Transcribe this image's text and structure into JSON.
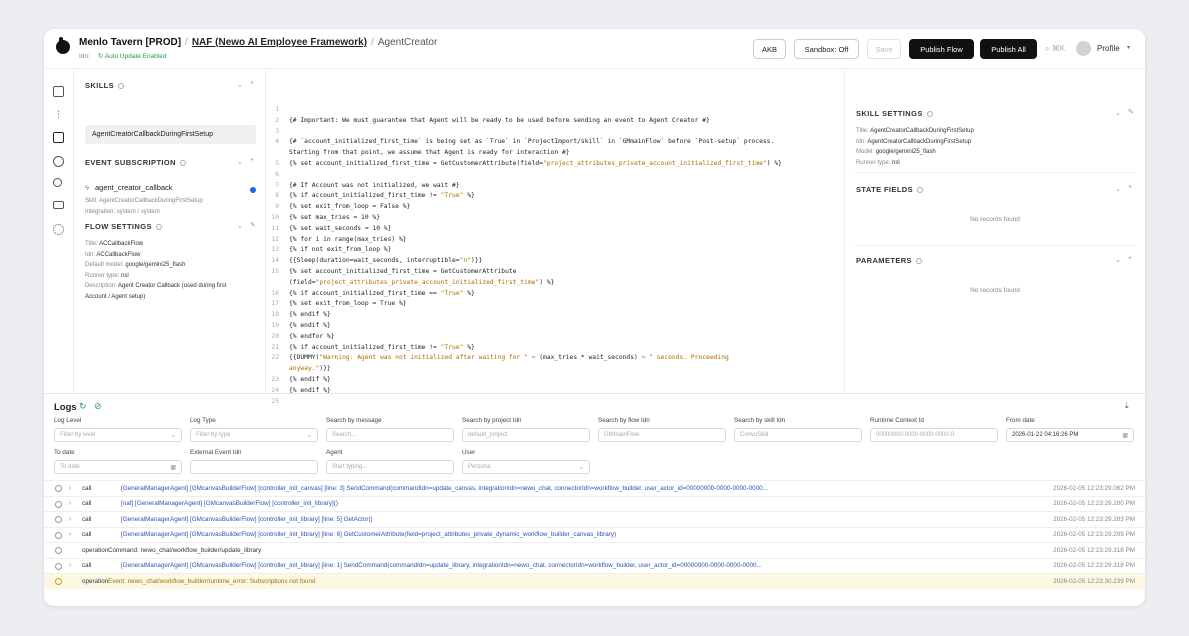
{
  "header": {
    "org": "Menlo Tavern [PROD]",
    "project": "NAF (Newo AI Employee Framework)",
    "page": "AgentCreator",
    "idn_label": "Idn:",
    "auto_update": "↻ Auto Update Enabled",
    "buttons": {
      "akb": "AKB",
      "sandbox": "Sandbox: Off",
      "save": "Save",
      "publish_flow": "Publish Flow",
      "publish_all": "Publish All"
    },
    "search_shortcut": "⌕ ⌘K",
    "profile": "Profile"
  },
  "skills": {
    "title": "SKILLS",
    "selected": "AgentCreatorCallbackDuringFirstSetup"
  },
  "event_subscription": {
    "title": "EVENT SUBSCRIPTION",
    "event": "agent_creator_callback",
    "skill_label": "Skill:",
    "skill": "AgentCreatorCallbackDuringFirstSetup",
    "integration_label": "Integration:",
    "integration": "system / system"
  },
  "flow_settings": {
    "title": "FLOW SETTINGS",
    "title_label": "Title:",
    "title_val": "ACCallbackFlow",
    "idn_label": "Idn:",
    "idn_val": "ACCallbackFlow",
    "model_label": "Default model:",
    "model_val": "google/gemini25_flash",
    "runner_label": "Runner type:",
    "runner_val": "nsl",
    "desc_label": "Description:",
    "desc_val1": "Agent Creator Callback (used during first",
    "desc_val2": "Account / Agent setup)"
  },
  "code": [
    {
      "n": "1",
      "t": ""
    },
    {
      "n": "2",
      "t": "{# Important: We must guarantee that Agent will be ready to be used before sending an event to Agent Creator #}"
    },
    {
      "n": "3",
      "t": ""
    },
    {
      "n": "4",
      "t": "{# `account_initialized_first_time` is being set as `True` in `ProjectImport/skill` in `GMmainFlow` before `Post-setup` process."
    },
    {
      "n": "",
      "t": "   Starting from that point, we assume that Agent is ready for interaction #}"
    },
    {
      "n": "5",
      "t": "{% set account_initialized_first_time = GetCustomerAttribute(field=",
      "s": "\"project_attributes_private_account_initialized_first_time\"",
      "e": ") %}"
    },
    {
      "n": "6",
      "t": ""
    },
    {
      "n": "7",
      "t": "{# If Account was not initialized, we wait #}"
    },
    {
      "n": "8",
      "t": "{% if account_initialized_first_time != ",
      "s": "\"True\"",
      "e": " %}"
    },
    {
      "n": "9",
      "t": "    {% set exit_from_loop = False %}"
    },
    {
      "n": "10",
      "t": "    {% set max_tries = 10 %}"
    },
    {
      "n": "11",
      "t": "    {% set wait_seconds = 10 %}"
    },
    {
      "n": "12",
      "t": "    {% for i in range(max_tries) %}"
    },
    {
      "n": "13",
      "t": "        {% if not exit_from_loop %}"
    },
    {
      "n": "14",
      "t": "            {{Sleep(duration=wait_seconds, interruptible=",
      "s": "\"n\"",
      "e": ")}}"
    },
    {
      "n": "15",
      "t": "            {% set account_initialized_first_time = GetCustomerAttribute"
    },
    {
      "n": "",
      "t": "            (field=",
      "s": "\"project_attributes_private_account_initialized_first_time\"",
      "e": ") %}"
    },
    {
      "n": "16",
      "t": "            {% if account_initialized_first_time == ",
      "s": "\"True\"",
      "e": " %}"
    },
    {
      "n": "17",
      "t": "                {% set exit_from_loop = True %}"
    },
    {
      "n": "18",
      "t": "            {% endif %}"
    },
    {
      "n": "19",
      "t": "        {% endif %}"
    },
    {
      "n": "20",
      "t": "    {% endfor %}"
    },
    {
      "n": "21",
      "t": "    {% if account_initialized_first_time != ",
      "s": "\"True\"",
      "e": " %}"
    },
    {
      "n": "22",
      "t": "        {{DUMMY(",
      "s": "\"Warning: Agent was not initialized after waiting for \"",
      "e": " ~ (max_tries * wait_seconds) ~ ",
      "s2": "\" seconds. Proceeding"
    },
    {
      "n": "",
      "t": "",
      "s": "        anyway.\"",
      "e": ")}}"
    },
    {
      "n": "23",
      "t": "    {% endif %}"
    },
    {
      "n": "24",
      "t": "{% endif %}"
    },
    {
      "n": "25",
      "t": ""
    }
  ],
  "skill_settings": {
    "title": "SKILL SETTINGS",
    "title_label": "Title:",
    "title_val": "AgentCreatorCallbackDuringFirstSetup",
    "idn_label": "Idn:",
    "idn_val": "AgentCreatorCallbackDuringFirstSetup",
    "model_label": "Model:",
    "model_val": "google/gemini25_flash",
    "runner_label": "Runner type:",
    "runner_val": "nsl"
  },
  "state_fields": {
    "title": "STATE FIELDS",
    "empty": "No records found"
  },
  "parameters": {
    "title": "PARAMETERS",
    "empty": "No records found"
  },
  "logs": {
    "title": "Logs",
    "filters": {
      "level_label": "Log Level",
      "level_ph": "Filter by level",
      "type_label": "Log Type",
      "type_ph": "Filter by type",
      "msg_label": "Search by message",
      "msg_ph": "Search...",
      "proj_label": "Search by project Idn",
      "proj_ph": "default_project",
      "flow_label": "Search by flow Idn",
      "flow_ph": "GMmainFlow",
      "skill_label": "Search by skill Idn",
      "skill_ph": "ConvoSkill",
      "ctx_label": "Runtime Context Id",
      "ctx_ph": "00000000-0000-0000-0000-0",
      "from_label": "From date",
      "from_val": "2026-01-22 04:16:26 PM",
      "to_label": "To date",
      "to_ph": "To date",
      "ext_label": "External Event Idn",
      "agent_label": "Agent",
      "agent_ph": "Start typing...",
      "user_label": "User",
      "user_ph": "Persona"
    },
    "rows": [
      {
        "type": "call",
        "msg": "[GeneralManagerAgent] [GMcanvasBuilderFlow] [controller_init_canvas] [line: 3] SendCommand(commandIdn=update_canvas, integrationIdn=newo_chat, connectorIdn=workflow_builder, user_actor_id=00000000-0000-0000-0000...",
        "ts": "2026-02-05 12:23:29.062 PM",
        "kind": "link"
      },
      {
        "type": "call",
        "msg": "[naf] [GeneralManagerAgent] [GMcanvasBuilderFlow] [controller_init_library]()",
        "ts": "2026-02-05 12:23:29.280 PM",
        "kind": "link"
      },
      {
        "type": "call",
        "msg": "[GeneralManagerAgent] [GMcanvasBuilderFlow] [controller_init_library] [line: 5] GetActor()",
        "ts": "2026-02-05 12:23:29.283 PM",
        "kind": "link"
      },
      {
        "type": "call",
        "msg": "[GeneralManagerAgent] [GMcanvasBuilderFlow] [controller_init_library] [line: 6] GetCustomerAttribute(field=project_attributes_private_dynamic_workflow_builder_canvas_library)",
        "ts": "2026-02-05 12:23:29.299 PM",
        "kind": "link"
      },
      {
        "type": "operation",
        "msg": "Command: newo_chat/workflow_builder/update_library",
        "ts": "2026-02-05 12:23:29.318 PM",
        "kind": "plain"
      },
      {
        "type": "call",
        "msg": "[GeneralManagerAgent] [GMcanvasBuilderFlow] [controller_init_library] [line: 1] SendCommand(commandIdn=update_library, integrationIdn=newo_chat, connectorIdn=workflow_builder, user_actor_id=00000000-0000-0000-0000...",
        "ts": "2026-02-05 12:23:29.318 PM",
        "kind": "link"
      },
      {
        "type": "operation",
        "msg": "Event: newo_chat/workflow_builder/runtime_error: Subscriptions not found",
        "ts": "2026-02-05 12:23:30.239 PM",
        "kind": "warn"
      }
    ]
  }
}
